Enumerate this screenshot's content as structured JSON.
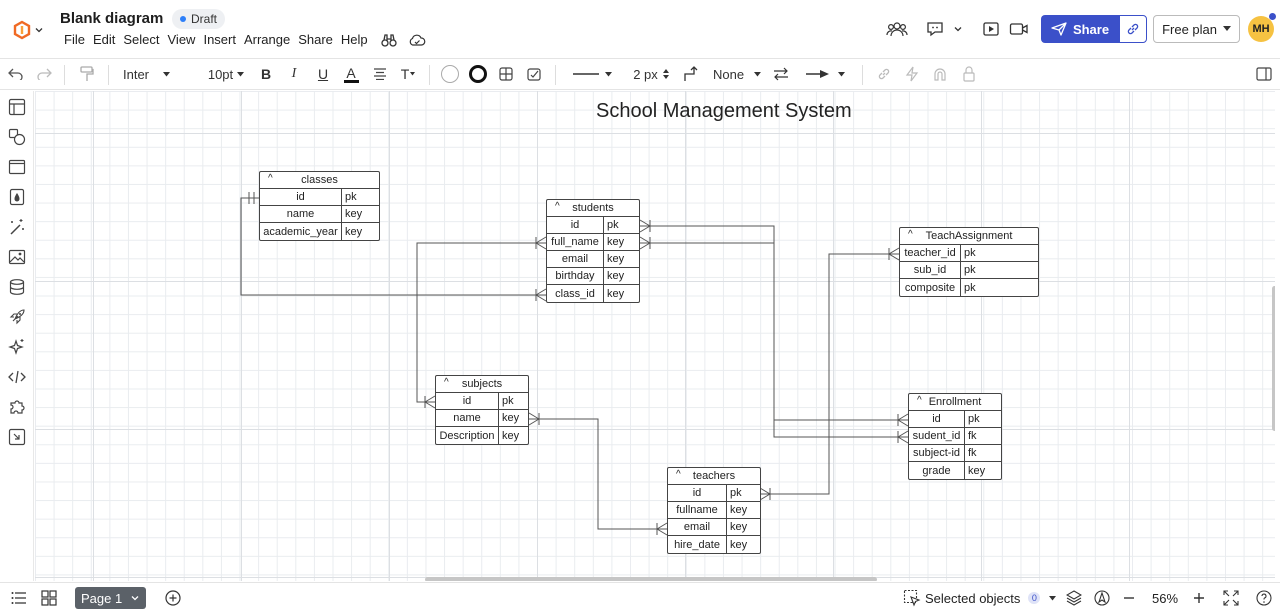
{
  "app": {
    "title": "Blank diagram",
    "status": "Draft"
  },
  "menu": [
    "File",
    "Edit",
    "Select",
    "View",
    "Insert",
    "Arrange",
    "Share",
    "Help"
  ],
  "header": {
    "share_label": "Share",
    "plan_label": "Free plan",
    "avatar_initials": "MH"
  },
  "toolbar": {
    "font_family": "Inter",
    "font_size": "10pt",
    "bold": "B",
    "italic": "I",
    "underline": "U",
    "text_color": "A",
    "text_style": "T",
    "line_width": "2 px",
    "endpoint": "None"
  },
  "canvas": {
    "title": "School Management System"
  },
  "entities": {
    "classes": {
      "title": "classes",
      "rows": [
        {
          "name": "id",
          "key": "pk"
        },
        {
          "name": "name",
          "key": "key"
        },
        {
          "name": "academic_year",
          "key": "key"
        }
      ]
    },
    "students": {
      "title": "students",
      "rows": [
        {
          "name": "id",
          "key": "pk"
        },
        {
          "name": "full_name",
          "key": "key"
        },
        {
          "name": "email",
          "key": "key"
        },
        {
          "name": "birthday",
          "key": "key"
        },
        {
          "name": "class_id",
          "key": "key"
        }
      ]
    },
    "teach_assignment": {
      "title": "TeachAssignment",
      "rows": [
        {
          "name": "teacher_id",
          "key": "pk"
        },
        {
          "name": "sub_id",
          "key": "pk"
        },
        {
          "name": "composite",
          "key": "pk"
        }
      ]
    },
    "subjects": {
      "title": "subjects",
      "rows": [
        {
          "name": "id",
          "key": "pk"
        },
        {
          "name": "name",
          "key": "key"
        },
        {
          "name": "Description",
          "key": "key"
        }
      ]
    },
    "enrollment": {
      "title": "Enrollment",
      "rows": [
        {
          "name": "id",
          "key": "pk"
        },
        {
          "name": "sudent_id",
          "key": "fk"
        },
        {
          "name": "subject-id",
          "key": "fk"
        },
        {
          "name": "grade",
          "key": "key"
        }
      ]
    },
    "teachers": {
      "title": "teachers",
      "rows": [
        {
          "name": "id",
          "key": "pk"
        },
        {
          "name": "fullname",
          "key": "key"
        },
        {
          "name": "email",
          "key": "key"
        },
        {
          "name": "hire_date",
          "key": "key"
        }
      ]
    }
  },
  "footer": {
    "page_label": "Page 1",
    "selected_label": "Selected objects",
    "selected_count": "0",
    "zoom": "56%"
  },
  "colors": {
    "accent": "#3b50c9",
    "avatar": "#f6c242",
    "page_tab": "#5b6168"
  }
}
